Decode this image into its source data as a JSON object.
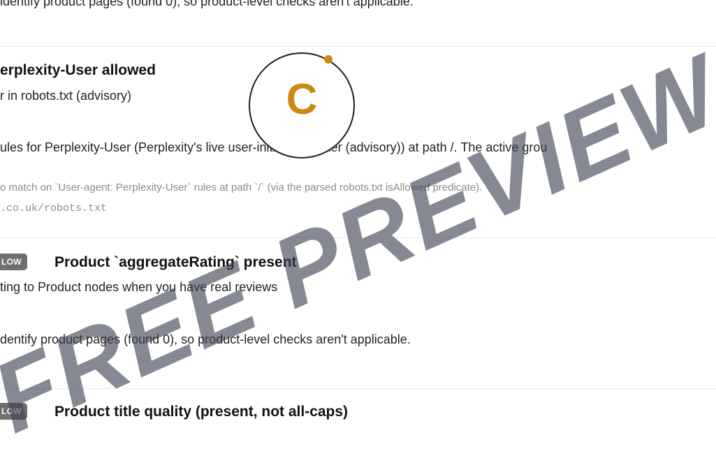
{
  "section_top": {
    "detail_text": "identify product pages (found 0), so product-level checks aren't applicable."
  },
  "check_perplexity": {
    "title": "erplexity-User allowed",
    "subtitle": "r in robots.txt (advisory)",
    "description": "ules for Perplexity-User (Perplexity's live user-initiated fetcher (advisory)) at path /. The active grou",
    "method_note": "o match on `User-agent: Perplexity-User` rules at path `/` (via the parsed robots.txt isAllowed predicate).",
    "source_url": ".co.uk/robots.txt"
  },
  "check_aggregate_rating": {
    "badge": "LOW",
    "title": "Product `aggregateRating` present",
    "subtitle": "ting to Product nodes when you have real reviews",
    "detail_text": "dentify product pages (found 0), so product-level checks aren't applicable."
  },
  "check_title_quality": {
    "badge": "LOW",
    "title": "Product title quality (present, not all-caps)"
  },
  "logo": {
    "letter": "C",
    "accent_color": "#c98a12"
  },
  "watermark": {
    "text": "FREE PREVIEW"
  }
}
